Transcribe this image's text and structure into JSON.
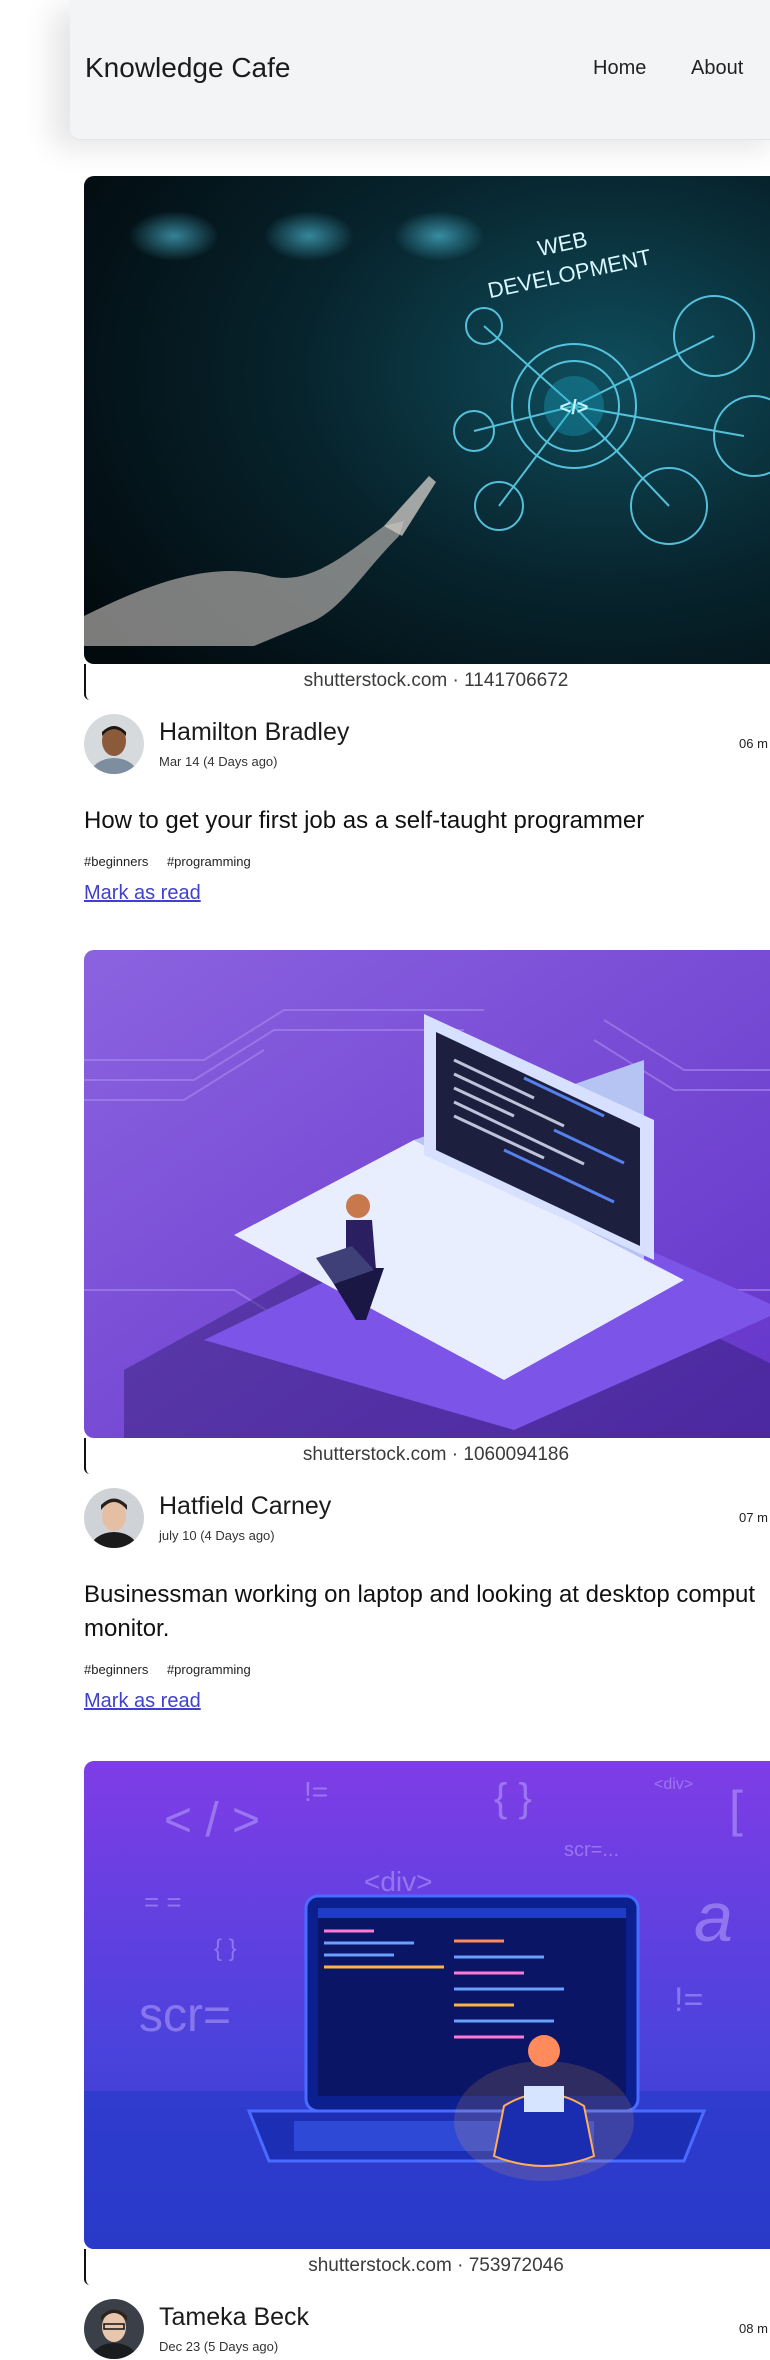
{
  "nav": {
    "brand": "Knowledge Cafe",
    "links": [
      "Home",
      "About"
    ]
  },
  "posts": [
    {
      "image_caption": "shutterstock.com · 1141706672",
      "image_text": [
        "WEB",
        "DEVELOPMENT"
      ],
      "author": "Hamilton Bradley",
      "date": "Mar 14 (4 Days ago)",
      "read_time": "06 m",
      "title": "How to get your first job as a self-taught programmer",
      "tags": [
        "#beginners",
        "#programming"
      ],
      "mark_label": "Mark as read"
    },
    {
      "image_caption": "shutterstock.com · 1060094186",
      "author": "Hatfield Carney",
      "date": "july 10 (4 Days ago)",
      "read_time": "07 m",
      "title": "Businessman working on laptop and looking at desktop comput",
      "title_line2": "monitor.",
      "tags": [
        "#beginners",
        "#programming"
      ],
      "mark_label": "Mark as read"
    },
    {
      "image_caption": "shutterstock.com · 753972046",
      "image_text": [
        "< / >",
        "!=",
        "{ }",
        "<div>",
        "scr=...",
        "= =",
        "{ }",
        "<div>",
        "scr=",
        "!=",
        "[",
        "a"
      ],
      "author": "Tameka Beck",
      "date": "Dec 23 (5 Days ago)",
      "read_time": "08 m"
    }
  ]
}
